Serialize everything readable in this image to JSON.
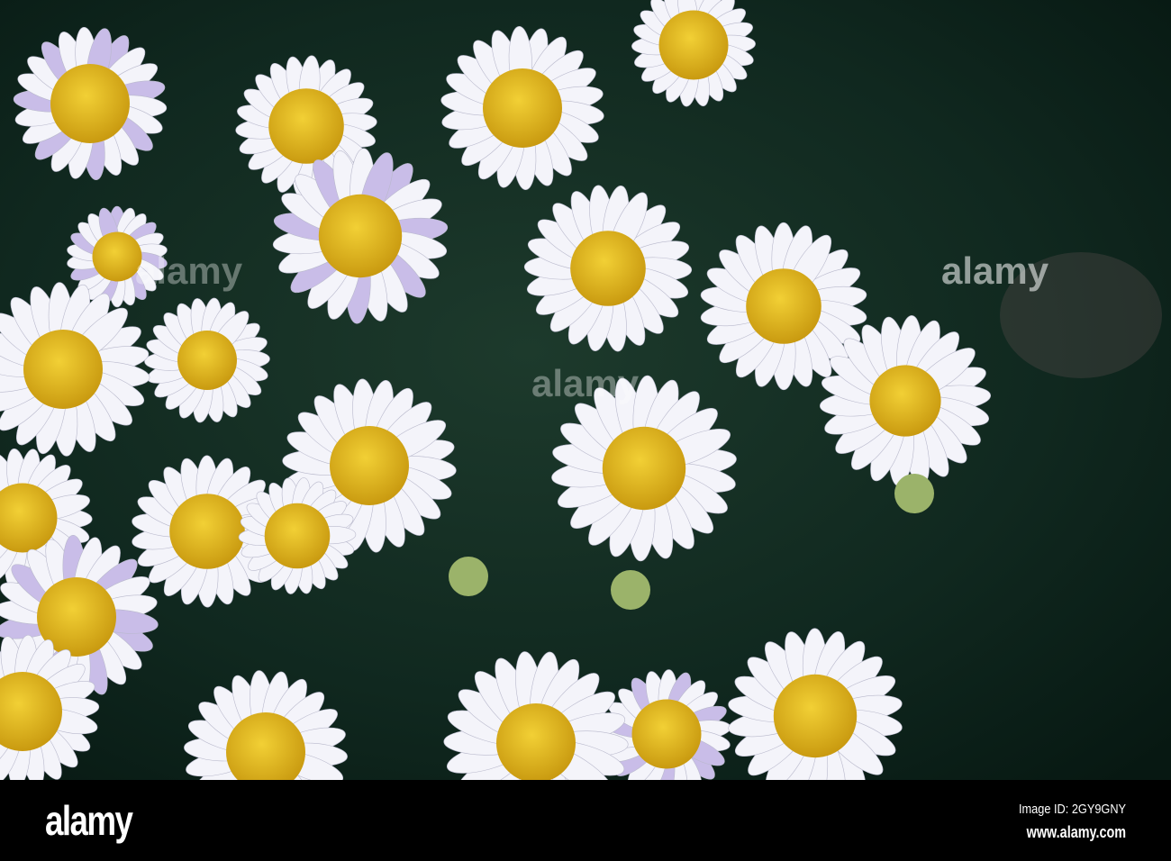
{
  "photo": {
    "subject": "daisies",
    "colors": {
      "background": "#0f2a22",
      "petal": "#f4f4fa",
      "petal_tint": "#c9bde8",
      "center": "#e6bf1c",
      "center_dark": "#c99a10"
    }
  },
  "watermark": {
    "text": "alamy"
  },
  "footer": {
    "logo": "alamy",
    "image_id": "Image ID: 2GY9GNY",
    "url": "www.alamy.com"
  }
}
